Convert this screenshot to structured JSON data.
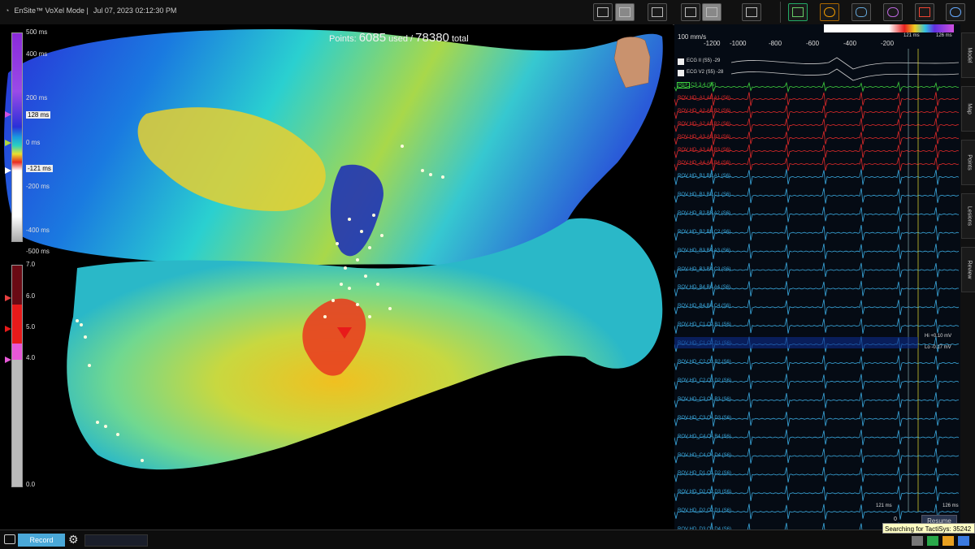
{
  "app": {
    "title": "EnSite™ VoXel Mode |",
    "datetime": "Jul 07, 2023 02:12:30 PM"
  },
  "toolbar": {
    "icons": [
      "zoom-icon",
      "selection-icon",
      "map-window-icon",
      "dual-map-icon",
      "single-view-icon",
      "layout-icon",
      "monitor-icon",
      "catheter-icon",
      "heart-surface-icon",
      "rotation-icon",
      "ablation-icon",
      "compass-icon"
    ]
  },
  "map": {
    "points_label": "Points:",
    "used": "6085",
    "used_label": "used /",
    "total": "78380",
    "total_label": "total",
    "scale1_ticks": [
      "500 ms",
      "400 ms",
      "200 ms",
      "128 ms",
      "0 ms",
      "-121 ms",
      "-200 ms",
      "-400 ms",
      "-500 ms"
    ],
    "scale2_ticks": [
      "7.0",
      "6.0",
      "5.0",
      "4.0",
      "0.0"
    ]
  },
  "ekg": {
    "speed": "100 mm/s",
    "time_ticks": [
      "-1200",
      "-1000",
      "-800",
      "-600",
      "-400",
      "-200"
    ],
    "window_left": "121 ms",
    "window_right": "126 ms",
    "ecg_labels": [
      "ECG II (S5) -29",
      "ECG V2 (S5) -28"
    ],
    "ref_badge": "REF",
    "ref_label": "CS 3,4 (S5)",
    "hi_label": "Hi +0.10 mV",
    "lo_label": "Lo -0.17 mV",
    "bottom_left": "121 ms",
    "bottom_right": "126 ms",
    "cursor_label": "0",
    "red_channels": [
      "ROV HD_A1,A2,A1 (S6)",
      "ROV HD_A2,A1,B2 (S6)",
      "ROV HD_A2,A3,B2 (S6)",
      "ROV HD_A3,A3,B3 (S6)",
      "ROV HD_A3,A4,B3 (S6)",
      "ROV HD_A4,A4,B4 (S6)"
    ],
    "blue_channels": [
      "ROV HD_B1,B2,A1 (S6)",
      "ROV HD_B1,B2,C1 (S6)",
      "ROV HD_B2,B3,A2 (S6)",
      "ROV HD_B2,B3,C2 (S6)",
      "ROV HD_B3,B4,A3 (S6)",
      "ROV HD_B3,B4,C3 (S6)",
      "ROV HD_B4,B4,A4 (S6)",
      "ROV HD_B4,B4,C4 (S6)",
      "ROV HD_C1,C2,B1 (S6)",
      "ROV HD_C1,C2,D1 (S6)",
      "ROV HD_C2,C3,B2 (S6)",
      "ROV HD_C2,C3,D2 (S6)",
      "ROV HD_C3,C4,B3 (S6)",
      "ROV HD_C3,C4,D3 (S6)",
      "ROV HD_C4,C4,B4 (S6)",
      "ROV HD_C4,C4,D4 (S6)",
      "ROV HD_D1,C1,D2 (S6)",
      "ROV HD_D2,C2,D3 (S6)",
      "ROV HD_D2,C2,D1 (S6)",
      "ROV HD_D3,C3,D4 (S6)",
      "ROV HD_D3,C3,D2 (S6)",
      "ROV HD_D4,C4,D3 (S6)"
    ]
  },
  "side_tabs": [
    "Model",
    "Map",
    "Points",
    "Lesions",
    "Review"
  ],
  "bottom": {
    "record_label": "Record",
    "resume_label": "Resume",
    "search_text": "Searching for TactiSys: 35242"
  },
  "colors": {
    "accent": "#4aa8d8",
    "red_trace": "#e02a2a",
    "blue_trace": "#3aa8dd",
    "ref_green": "#3fd23f"
  }
}
